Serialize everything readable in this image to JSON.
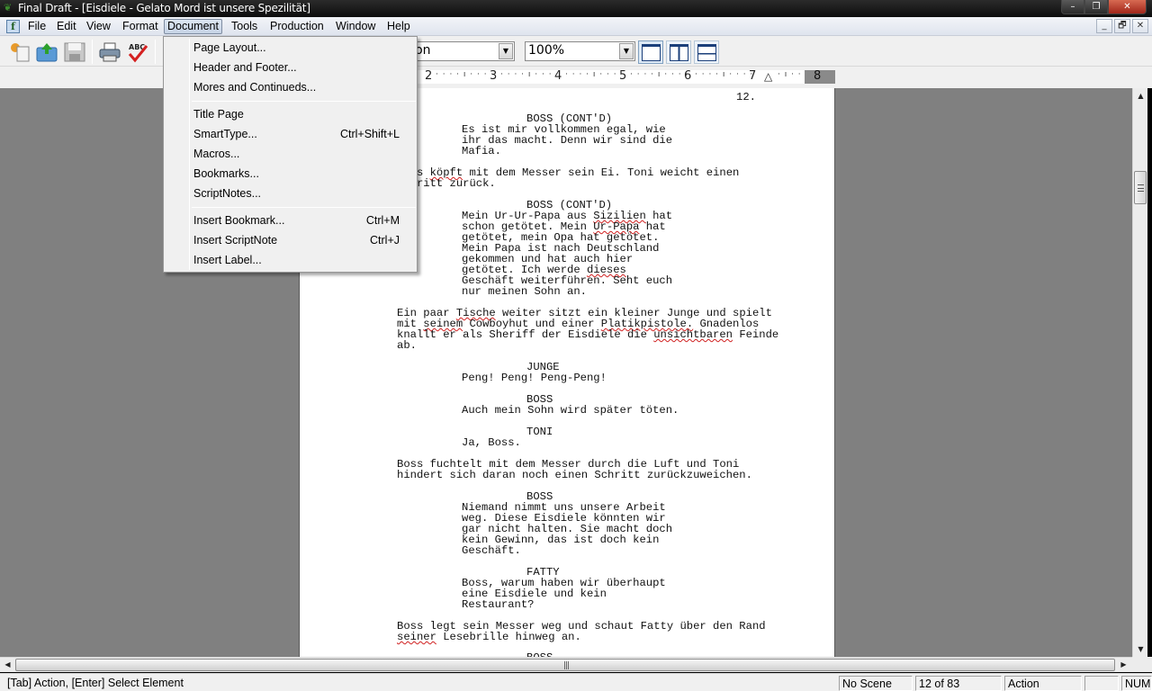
{
  "window": {
    "title": "Final Draft - [Eisdiele - Gelato Mord ist unsere Spezilität]",
    "controls": {
      "minimize": "–",
      "restore": "❐",
      "close": "✕"
    },
    "mdi_controls": {
      "minimize": "_",
      "restore": "🗗",
      "close": "✕"
    }
  },
  "menubar": {
    "app_icon": "f",
    "items": [
      {
        "label": "File"
      },
      {
        "label": "Edit"
      },
      {
        "label": "View"
      },
      {
        "label": "Format"
      },
      {
        "label": "Document",
        "active": true
      },
      {
        "label": "Tools"
      },
      {
        "label": "Production"
      },
      {
        "label": "Window"
      },
      {
        "label": "Help"
      }
    ]
  },
  "toolbar": {
    "icons": [
      "new-document-icon",
      "open-folder-icon",
      "save-icon",
      "print-icon",
      "spellcheck-icon"
    ],
    "element_combo": {
      "value": "Action",
      "visible_text": "ction"
    },
    "zoom_combo": {
      "value": "100%"
    },
    "view_buttons": [
      "normal-view",
      "speed-view",
      "page-view"
    ]
  },
  "ruler": {
    "numbers": [
      "2",
      "3",
      "4",
      "5",
      "6",
      "7",
      "8"
    ]
  },
  "document_menu": {
    "groups": [
      [
        {
          "label": "Page Layout...",
          "shortcut": ""
        },
        {
          "label": "Header and Footer...",
          "shortcut": ""
        },
        {
          "label": "Mores and Continueds...",
          "shortcut": ""
        }
      ],
      [
        {
          "label": "Title Page",
          "shortcut": ""
        },
        {
          "label": "SmartType...",
          "shortcut": "Ctrl+Shift+L"
        },
        {
          "label": "Macros...",
          "shortcut": ""
        },
        {
          "label": "Bookmarks...",
          "shortcut": ""
        },
        {
          "label": "ScriptNotes...",
          "shortcut": ""
        }
      ],
      [
        {
          "label": "Insert Bookmark...",
          "shortcut": "Ctrl+M"
        },
        {
          "label": "Insert ScriptNote",
          "shortcut": "Ctrl+J"
        },
        {
          "label": "Insert Label...",
          "shortcut": ""
        }
      ]
    ]
  },
  "script": {
    "page_number": "12.",
    "elements": [
      {
        "type": "character",
        "text": "BOSS (CONT'D)"
      },
      {
        "type": "dialogue",
        "lines": [
          "Es ist mir vollkommen egal, wie",
          "ihr das macht. Denn wir sind die",
          "Mafia."
        ]
      },
      {
        "type": "action",
        "lines": [
          "Boss köpft mit dem Messer sein Ei. Toni weicht einen",
          "Schritt zurück."
        ]
      },
      {
        "type": "character",
        "text": "BOSS (CONT'D)"
      },
      {
        "type": "dialogue",
        "lines": [
          "Mein Ur-Ur-Papa aus Sizilien hat",
          "schon getötet. Mein Ur-Papa hat",
          "getötet, mein Opa hat getötet.",
          "Mein Papa ist nach Deutschland",
          "gekommen und hat auch hier",
          "getötet. Ich werde dieses",
          "Geschäft weiterführen. Seht euch",
          "nur meinen Sohn an."
        ]
      },
      {
        "type": "action",
        "lines": [
          "Ein paar Tische weiter sitzt ein kleiner Junge und spielt",
          "mit seinem Cowboyhut und einer Platikpistole. Gnadenlos",
          "knallt er als Sheriff der Eisdiele die unsichtbaren Feinde",
          "ab."
        ]
      },
      {
        "type": "character",
        "text": "JUNGE"
      },
      {
        "type": "dialogue",
        "lines": [
          "Peng! Peng! Peng-Peng!"
        ]
      },
      {
        "type": "character",
        "text": "BOSS"
      },
      {
        "type": "dialogue",
        "lines": [
          "Auch mein Sohn wird später töten."
        ]
      },
      {
        "type": "character",
        "text": "TONI"
      },
      {
        "type": "dialogue",
        "lines": [
          "Ja, Boss."
        ]
      },
      {
        "type": "action",
        "lines": [
          "Boss fuchtelt mit dem Messer durch die Luft und Toni",
          "hindert sich daran noch einen Schritt zurückzuweichen."
        ]
      },
      {
        "type": "character",
        "text": "BOSS"
      },
      {
        "type": "dialogue",
        "lines": [
          "Niemand nimmt uns unsere Arbeit",
          "weg. Diese Eisdiele könnten wir",
          "gar nicht halten. Sie macht doch",
          "kein Gewinn, das ist doch kein",
          "Geschäft."
        ]
      },
      {
        "type": "character",
        "text": "FATTY"
      },
      {
        "type": "dialogue",
        "lines": [
          "Boss, warum haben wir überhaupt",
          "eine Eisdiele und kein",
          "Restaurant?"
        ]
      },
      {
        "type": "action",
        "lines": [
          "Boss legt sein Messer weg und schaut Fatty über den Rand",
          "seiner Lesebrille hinweg an."
        ]
      },
      {
        "type": "character",
        "text": "BOSS"
      }
    ],
    "spellcheck_flagged": [
      "köpft",
      "Sizilien",
      "Ur-Papa",
      "dieses",
      "Tische",
      "seinem",
      "Platikpistole.",
      "unsichtbaren",
      "seiner"
    ]
  },
  "statusbar": {
    "hint": "[Tab]  Action,  [Enter] Select Element",
    "scene": "No Scene",
    "page": "12  of  83",
    "element": "Action",
    "blank": "",
    "num": "NUM"
  }
}
